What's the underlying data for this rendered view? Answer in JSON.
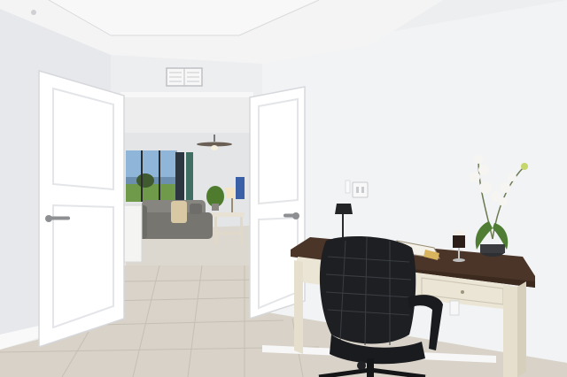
{
  "scene": {
    "subject": "interior-home-office-view",
    "colors": {
      "wall": "#f1f2f3",
      "wall_shade": "#e4e5e8",
      "ceiling": "#f3f3f4",
      "door": "#ffffff",
      "door_edge": "#d6d8dc",
      "tile": "#d9d4cb",
      "grout": "#c5bfb4",
      "desk_top": "#4a3426",
      "desk_body": "#ece6d7",
      "chair": "#1d1f22",
      "sofa": "#7b7a76",
      "orchid_flower": "#f7f5f2",
      "leaf": "#4e7d33"
    },
    "icons": [
      "ceiling-fan-icon",
      "door-handle-icon",
      "lamp-icon",
      "light-switch-icon",
      "hvac-vent-icon"
    ]
  }
}
